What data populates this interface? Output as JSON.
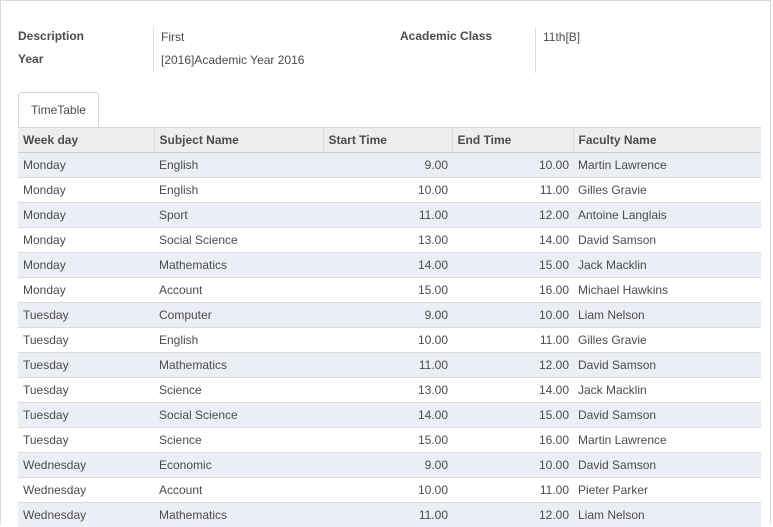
{
  "form": {
    "description_label": "Description",
    "description_value": "First",
    "year_label": "Year",
    "year_value": "[2016]Academic Year 2016",
    "class_label": "Academic Class",
    "class_value": "11th[B]"
  },
  "tab": {
    "label": "TimeTable"
  },
  "table": {
    "headers": [
      "Week day",
      "Subject Name",
      "Start Time",
      "End Time",
      "Faculty Name"
    ],
    "rows": [
      [
        "Monday",
        "English",
        "9.00",
        "10.00",
        "Martin Lawrence"
      ],
      [
        "Monday",
        "English",
        "10.00",
        "11.00",
        "Gilles Gravie"
      ],
      [
        "Monday",
        "Sport",
        "11.00",
        "12.00",
        "Antoine Langlais"
      ],
      [
        "Monday",
        "Social Science",
        "13.00",
        "14.00",
        "David Samson"
      ],
      [
        "Monday",
        "Mathematics",
        "14.00",
        "15.00",
        "Jack Macklin"
      ],
      [
        "Monday",
        "Account",
        "15.00",
        "16.00",
        "Michael Hawkins"
      ],
      [
        "Tuesday",
        "Computer",
        "9.00",
        "10.00",
        "Liam Nelson"
      ],
      [
        "Tuesday",
        "English",
        "10.00",
        "11.00",
        "Gilles Gravie"
      ],
      [
        "Tuesday",
        "Mathematics",
        "11.00",
        "12.00",
        "David Samson"
      ],
      [
        "Tuesday",
        "Science",
        "13.00",
        "14.00",
        "Jack Macklin"
      ],
      [
        "Tuesday",
        "Social Science",
        "14.00",
        "15.00",
        "David Samson"
      ],
      [
        "Tuesday",
        "Science",
        "15.00",
        "16.00",
        "Martin Lawrence"
      ],
      [
        "Wednesday",
        "Economic",
        "9.00",
        "10.00",
        "David Samson"
      ],
      [
        "Wednesday",
        "Account",
        "10.00",
        "11.00",
        "Pieter Parker"
      ],
      [
        "Wednesday",
        "Mathematics",
        "11.00",
        "12.00",
        "Liam Nelson"
      ]
    ]
  }
}
